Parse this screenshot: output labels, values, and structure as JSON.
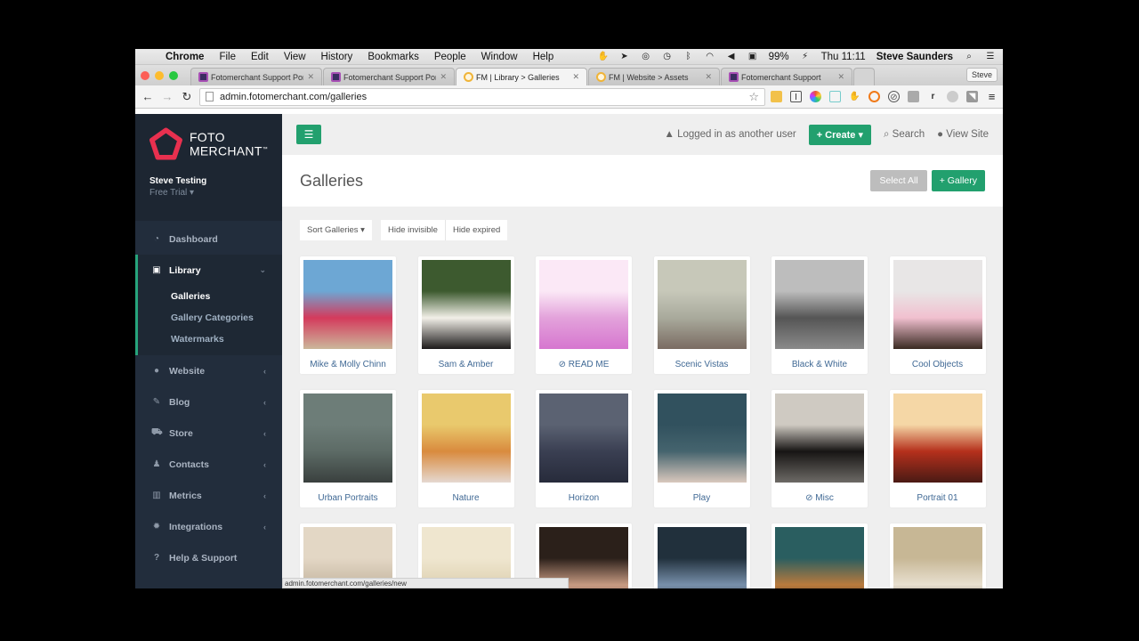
{
  "menubar": {
    "app": "Chrome",
    "items": [
      "File",
      "Edit",
      "View",
      "History",
      "Bookmarks",
      "People",
      "Window",
      "Help"
    ],
    "battery": "99%",
    "clock": "Thu 11:11",
    "user": "Steve Saunders"
  },
  "browser": {
    "tabs": [
      {
        "title": "Fotomerchant Support Por",
        "icon": "purple",
        "active": false
      },
      {
        "title": "Fotomerchant Support Por",
        "icon": "purple",
        "active": false
      },
      {
        "title": "FM | Library > Galleries",
        "icon": "ring",
        "active": true
      },
      {
        "title": "FM | Website > Assets",
        "icon": "ring",
        "active": false
      },
      {
        "title": "Fotomerchant Support",
        "icon": "purple",
        "active": false
      }
    ],
    "profile": "Steve",
    "url": "admin.fotomerchant.com/galleries",
    "status_url": "admin.fotomerchant.com/galleries/new"
  },
  "brand": {
    "line1": "FOTO",
    "line2": "MERCHANT",
    "tm": "™",
    "accent": "#e8304f"
  },
  "account": {
    "name": "Steve Testing",
    "plan": "Free Trial"
  },
  "sidebar": {
    "items": [
      {
        "label": "Dashboard",
        "icon": "dashboard-icon",
        "glyph": "◔"
      },
      {
        "label": "Library",
        "icon": "image-icon",
        "glyph": "▣",
        "expanded": true,
        "children": [
          {
            "label": "Galleries",
            "active": true
          },
          {
            "label": "Gallery Categories",
            "active": false
          },
          {
            "label": "Watermarks",
            "active": false
          }
        ]
      },
      {
        "label": "Website",
        "icon": "globe-icon",
        "glyph": "●"
      },
      {
        "label": "Blog",
        "icon": "edit-icon",
        "glyph": "✎"
      },
      {
        "label": "Store",
        "icon": "cart-icon",
        "glyph": "⛟"
      },
      {
        "label": "Contacts",
        "icon": "user-icon",
        "glyph": "♟"
      },
      {
        "label": "Metrics",
        "icon": "bar-chart-icon",
        "glyph": "▥"
      },
      {
        "label": "Integrations",
        "icon": "gear-icon",
        "glyph": "✹"
      },
      {
        "label": "Help & Support",
        "icon": "question-icon",
        "glyph": "?"
      }
    ]
  },
  "topbar": {
    "notice": "Logged in as another user",
    "create": "+ Create ▾",
    "search": "Search",
    "view_site": "View Site"
  },
  "page": {
    "title": "Galleries",
    "select_all": "Select All",
    "add_gallery": "+ Gallery"
  },
  "filters": {
    "sort": "Sort Galleries ▾",
    "hide_invisible": "Hide invisible",
    "hide_expired": "Hide expired"
  },
  "galleries": [
    {
      "name": "Mike & Molly Chinn",
      "hidden": false,
      "colors": [
        "#6da7d4",
        "#d43a5c",
        "#cbb79b"
      ]
    },
    {
      "name": "Sam & Amber",
      "hidden": false,
      "colors": [
        "#3d5a2f",
        "#f2efe8",
        "#1c1a1a"
      ]
    },
    {
      "name": "READ ME",
      "hidden": true,
      "colors": [
        "#fbe8f6",
        "#e3a2db",
        "#d676cf"
      ]
    },
    {
      "name": "Scenic Vistas",
      "hidden": false,
      "colors": [
        "#c7c8b9",
        "#a9aa9c",
        "#7a6b62"
      ]
    },
    {
      "name": "Black & White",
      "hidden": false,
      "colors": [
        "#bdbdbd",
        "#555555",
        "#8a8a8a"
      ]
    },
    {
      "name": "Cool Objects",
      "hidden": false,
      "colors": [
        "#e8e6e6",
        "#f1c0cf",
        "#3a2a22"
      ]
    },
    {
      "name": "Urban Portraits",
      "hidden": false,
      "colors": [
        "#6d7d78",
        "#5d6b66",
        "#3a403e"
      ]
    },
    {
      "name": "Nature",
      "hidden": false,
      "colors": [
        "#e9c96d",
        "#d98b3e",
        "#e5d8d0"
      ]
    },
    {
      "name": "Horizon",
      "hidden": false,
      "colors": [
        "#5b6272",
        "#3a3f52",
        "#272b3b"
      ]
    },
    {
      "name": "Play",
      "hidden": false,
      "colors": [
        "#31515e",
        "#45646e",
        "#d9c8bd"
      ]
    },
    {
      "name": "Misc",
      "hidden": true,
      "colors": [
        "#cfcac2",
        "#171514",
        "#6d6a66"
      ]
    },
    {
      "name": "Portrait 01",
      "hidden": false,
      "colors": [
        "#f5d7a6",
        "#b5301c",
        "#4a1a14"
      ]
    },
    {
      "name": "",
      "hidden": false,
      "colors": [
        "#e3d7c5",
        "#c7b8a3",
        "#8f6f52"
      ]
    },
    {
      "name": "",
      "hidden": false,
      "colors": [
        "#efe6cf",
        "#dfd2b3",
        "#5b4a45"
      ]
    },
    {
      "name": "",
      "hidden": false,
      "colors": [
        "#2b201a",
        "#c79a82",
        "#6d4a3c"
      ]
    },
    {
      "name": "",
      "hidden": false,
      "colors": [
        "#21303c",
        "#7890ab",
        "#1a1c20"
      ]
    },
    {
      "name": "",
      "hidden": false,
      "colors": [
        "#2a5e60",
        "#b97a3d",
        "#1a1818"
      ]
    },
    {
      "name": "",
      "hidden": false,
      "colors": [
        "#c7b795",
        "#e8e0d0",
        "#3b2b22"
      ]
    }
  ],
  "colors": {
    "accent_green": "#22a06e",
    "sidebar_bg": "#222d3c",
    "link_blue": "#3f6894"
  }
}
